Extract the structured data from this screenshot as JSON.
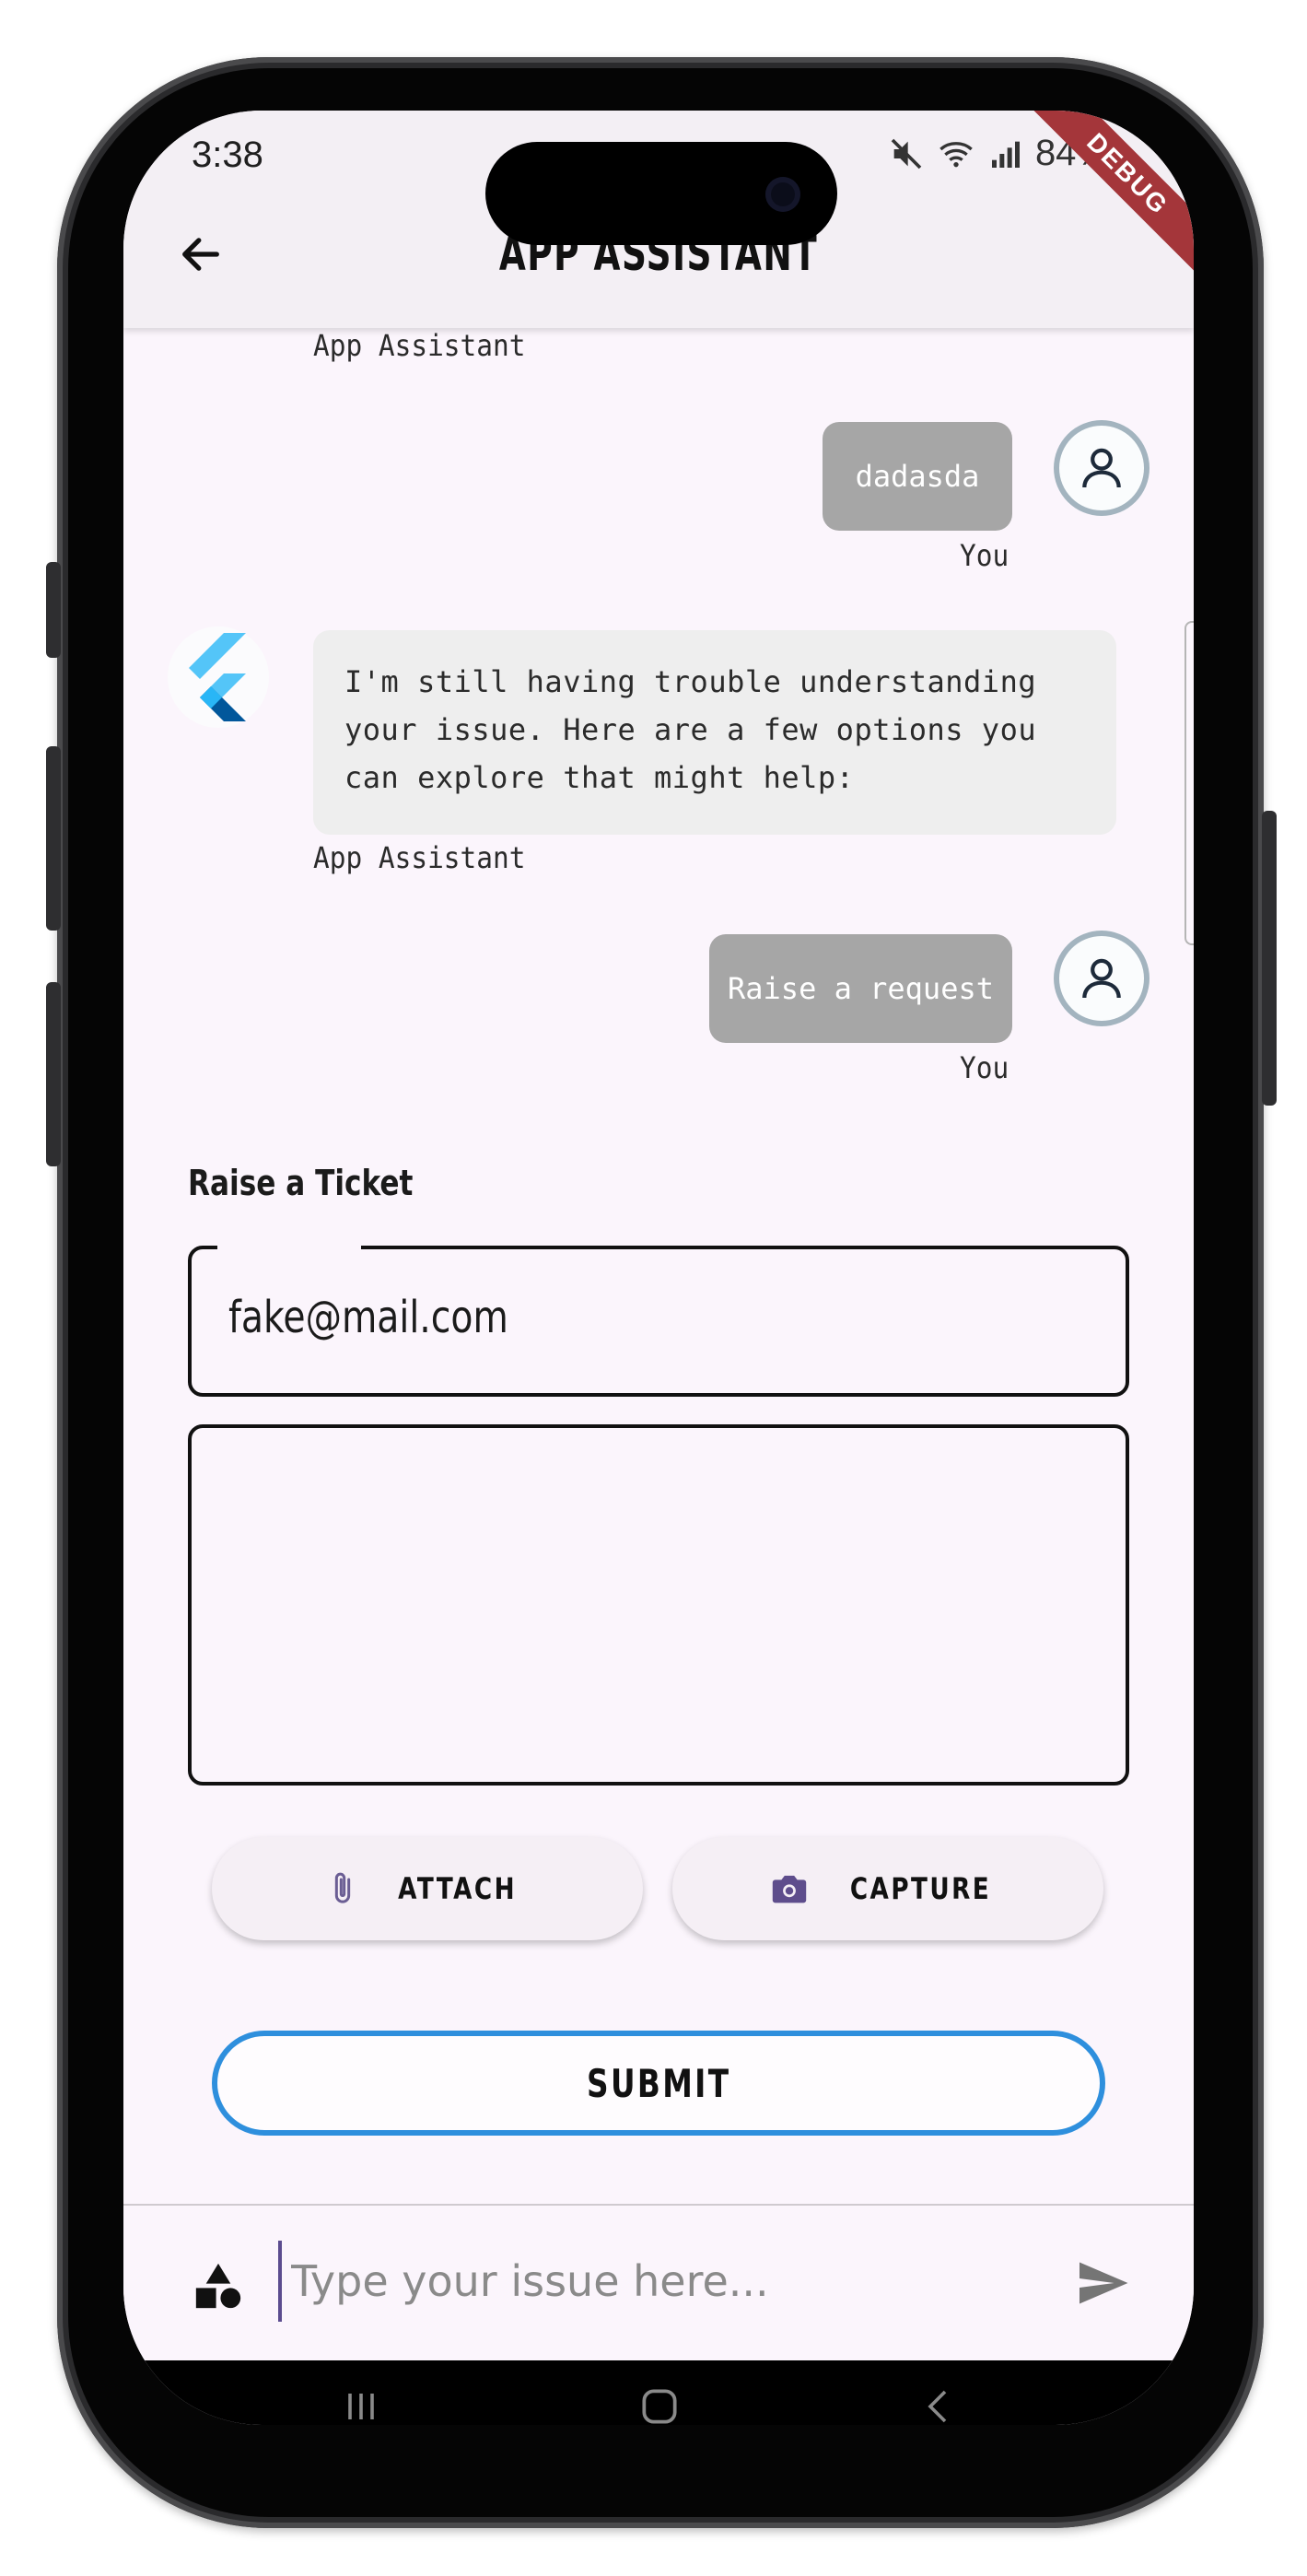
{
  "status_bar": {
    "time": "3:38",
    "battery": "84%"
  },
  "app_bar": {
    "title": "APP ASSISTANT",
    "debug_banner": "DEBUG"
  },
  "messages": [
    {
      "sender": "bot",
      "sender_label": "App Assistant",
      "text": ""
    },
    {
      "sender": "user",
      "sender_label": "You",
      "text": "dadasda"
    },
    {
      "sender": "bot",
      "sender_label": "App Assistant",
      "text": "I'm still having trouble understanding your issue. Here are a few options you can explore that might help:"
    },
    {
      "sender": "user",
      "sender_label": "You",
      "text": "Raise a request"
    }
  ],
  "ticket_form": {
    "heading": "Raise a Ticket",
    "email_value": "fake@mail.com",
    "description_value": "",
    "attach_label": "ATTACH",
    "capture_label": "CAPTURE",
    "submit_label": "SUBMIT"
  },
  "composer": {
    "placeholder": "Type your issue here..."
  },
  "colors": {
    "user_bubble": "#a6a6a6",
    "bot_bubble": "#eeeeee",
    "submit_border": "#2e8fdd",
    "camera_icon": "#5e4d8c",
    "background": "#fbf5fc"
  },
  "icons": {
    "back": "arrow-left-icon",
    "user_avatar": "person-icon",
    "bot_avatar": "flutter-logo-icon",
    "attach": "paperclip-icon",
    "capture": "camera-icon",
    "shapes": "shapes-icon",
    "send": "send-icon"
  }
}
